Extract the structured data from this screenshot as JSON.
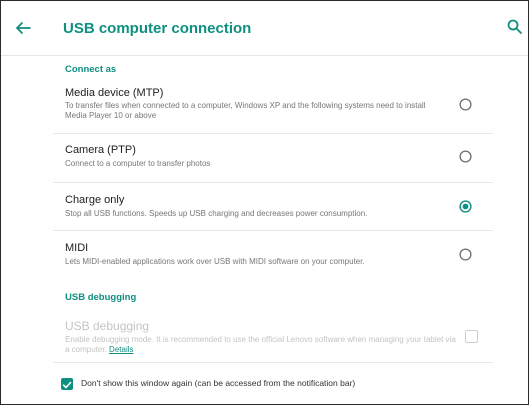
{
  "header": {
    "title": "USB computer connection",
    "back_icon": "arrow-left-icon",
    "search_icon": "search-icon"
  },
  "sections": {
    "connect_as": "Connect as",
    "usb_debugging": "USB debugging"
  },
  "options": [
    {
      "title": "Media device (MTP)",
      "description": "To transfer files when connected to a computer, Windows XP and the following systems need to install Media Player 10 or above",
      "selected": false
    },
    {
      "title": "Camera (PTP)",
      "description": "Connect to a computer to transfer photos",
      "selected": false
    },
    {
      "title": "Charge only",
      "description": "Stop all USB functions. Speeds up USB charging and decreases power consumption.",
      "selected": true
    },
    {
      "title": "MIDI",
      "description": "Lets MIDI-enabled applications work over USB with MIDI software on your computer.",
      "selected": false
    }
  ],
  "debugging": {
    "title": "USB debugging",
    "description": "Enable debugging mode. It is recommended to use the official Lenovo software when managing your tablet via a computer.",
    "details_link": "Details",
    "enabled": false,
    "checked": false
  },
  "footer": {
    "dont_show_label": "Don't show this window again (can be accessed from the notification bar)",
    "checked": true
  },
  "colors": {
    "accent": "#0f8f80",
    "disabled": "#c4c4c4"
  }
}
